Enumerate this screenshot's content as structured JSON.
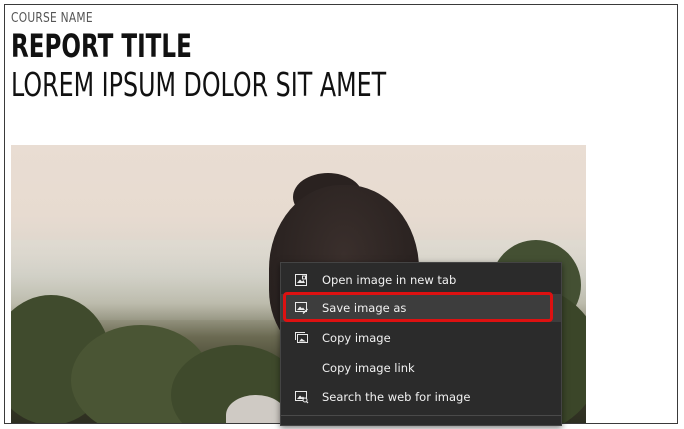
{
  "document": {
    "course_name": "COURSE NAME",
    "report_title": "REPORT TITLE",
    "subtitle": "LOREM IPSUM DOLOR SIT AMET"
  },
  "context_menu": {
    "items": [
      {
        "label": "Open image in new tab",
        "icon": "open-in-new-tab-icon"
      },
      {
        "label": "Save image as",
        "icon": "save-image-icon"
      },
      {
        "label": "Copy image",
        "icon": "copy-image-icon"
      },
      {
        "label": "Copy image link",
        "icon": ""
      },
      {
        "label": "Search the web for image",
        "icon": "search-image-icon"
      }
    ],
    "highlighted_item": "Save image as",
    "highlight_color": "#dd1111",
    "background_color": "#2b2b2b"
  }
}
